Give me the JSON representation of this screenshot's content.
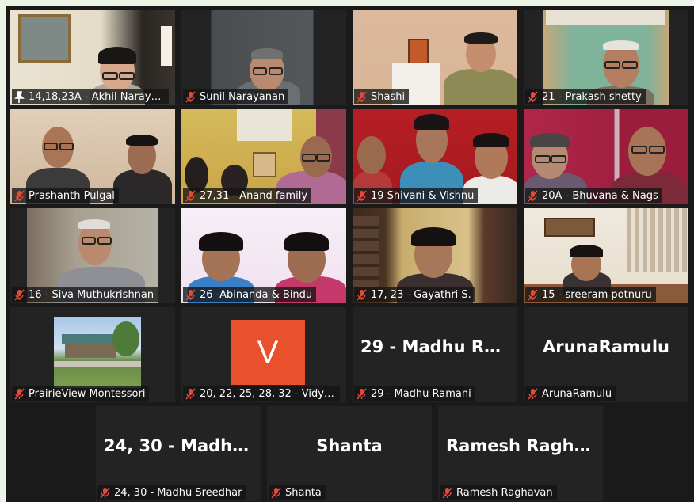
{
  "tiles": [
    {
      "name": "14,18,23A - Akhil Naraya...",
      "muted": false
    },
    {
      "name": "Sunil Narayanan",
      "muted": true
    },
    {
      "name": "Shashi",
      "muted": true
    },
    {
      "name": "21 - Prakash shetty",
      "muted": true
    },
    {
      "name": "Prashanth Pulgal",
      "muted": true
    },
    {
      "name": "27,31 - Anand family",
      "muted": true
    },
    {
      "name": "19 Shivani & Vishnu",
      "muted": true
    },
    {
      "name": "20A - Bhuvana & Nags",
      "muted": true
    },
    {
      "name": "16 - Siva Muthukrishnan",
      "muted": true
    },
    {
      "name": "26 -Abinanda & Bindu",
      "muted": true
    },
    {
      "name": "17, 23 - Gayathri S.",
      "muted": true
    },
    {
      "name": "15 - sreeram potnuru",
      "muted": true
    },
    {
      "name": "PrairieView Montessori",
      "muted": true
    },
    {
      "name": "20, 22, 25, 28, 32 - Vidya ...",
      "muted": true,
      "avatar_letter": "V",
      "avatar_color": "#e8512b"
    },
    {
      "name": "29 - Madhu Ramani",
      "muted": true,
      "display": "29 - Madhu Ra..."
    },
    {
      "name": "ArunaRamulu",
      "muted": true,
      "display": "ArunaRamulu"
    },
    {
      "name": "24, 30 - Madhu Sreedhar",
      "muted": true,
      "display": "24, 30 - Madhu..."
    },
    {
      "name": "Shanta",
      "muted": true,
      "display": "Shanta"
    },
    {
      "name": "Ramesh Raghavan",
      "muted": true,
      "display": "Ramesh Raghav..."
    }
  ],
  "colors": {
    "active_border": "#a5d15b",
    "muted_icon": "#e5493a",
    "tile_bg": "#232323"
  }
}
